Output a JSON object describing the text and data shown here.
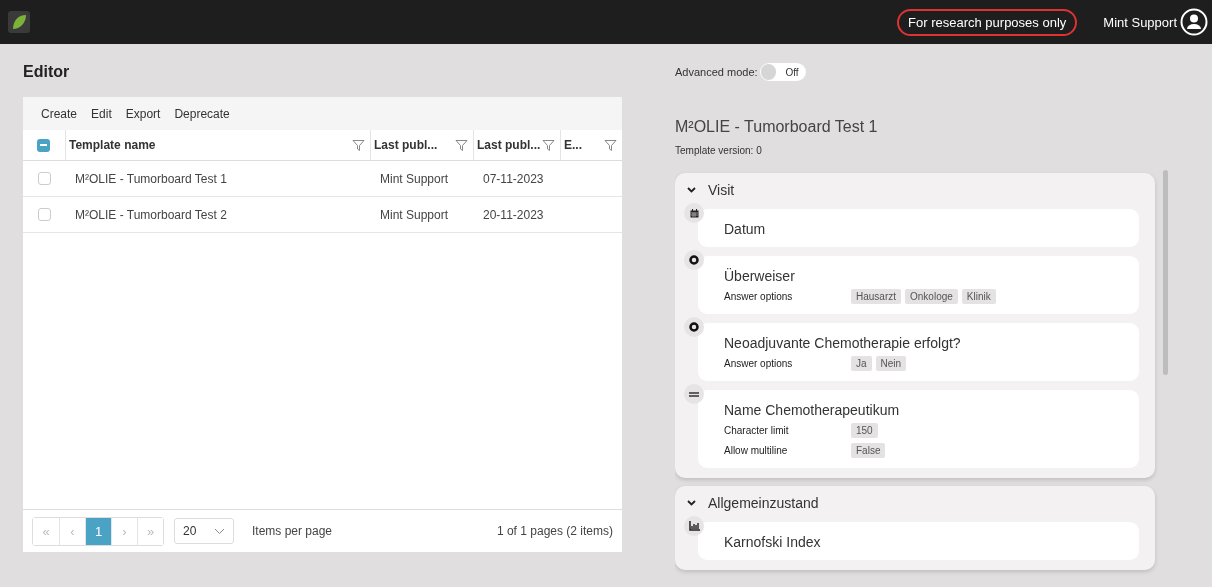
{
  "header": {
    "badge": "For research purposes only",
    "user": "Mint Support"
  },
  "editor": {
    "title": "Editor",
    "toolbar": [
      "Create",
      "Edit",
      "Export",
      "Deprecate"
    ],
    "select_all_partial": true,
    "columns": [
      {
        "label": "Template name"
      },
      {
        "label": "Last publ..."
      },
      {
        "label": "Last publ..."
      },
      {
        "label": "E..."
      }
    ],
    "rows": [
      {
        "checked": false,
        "cells": [
          "M²OLIE - Tumorboard Test 1",
          "Mint Support",
          "07-11-2023"
        ]
      },
      {
        "checked": false,
        "cells": [
          "M²OLIE - Tumorboard Test 2",
          "Mint Support",
          "20-11-2023"
        ]
      }
    ],
    "pagination": {
      "first": "«",
      "prev": "‹",
      "pages": [
        {
          "label": "1",
          "selected": true
        }
      ],
      "next": "›",
      "last": "»",
      "page_size": "20",
      "page_size_label": "Items per page",
      "summary": "1 of 1 pages (2 items)"
    }
  },
  "preview": {
    "advanced_mode": {
      "label": "Advanced mode:",
      "on": false,
      "state_text": "Off"
    },
    "title": "M²OLIE - Tumorboard Test 1",
    "version": "Template version: 0",
    "sections": [
      {
        "title": "Visit",
        "expanded": true,
        "fields": [
          {
            "kind": "date",
            "name": "Datum"
          },
          {
            "kind": "choice",
            "name": "Überweiser",
            "properties": [
              {
                "label": "Answer options",
                "values": [
                  "Hausarzt",
                  "Onkologe",
                  "Klinik"
                ]
              }
            ]
          },
          {
            "kind": "choice",
            "name": "Neoadjuvante Chemotherapie erfolgt?",
            "properties": [
              {
                "label": "Answer options",
                "values": [
                  "Ja",
                  "Nein"
                ]
              }
            ]
          },
          {
            "kind": "text",
            "name": "Name Chemotherapeutikum",
            "properties": [
              {
                "label": "Character limit",
                "values": [
                  "150"
                ]
              },
              {
                "label": "Allow multiline",
                "values": [
                  "False"
                ]
              }
            ]
          }
        ]
      },
      {
        "title": "Allgemeinzustand",
        "expanded": true,
        "fields": [
          {
            "kind": "scale",
            "name": "Karnofski Index"
          }
        ]
      }
    ]
  }
}
